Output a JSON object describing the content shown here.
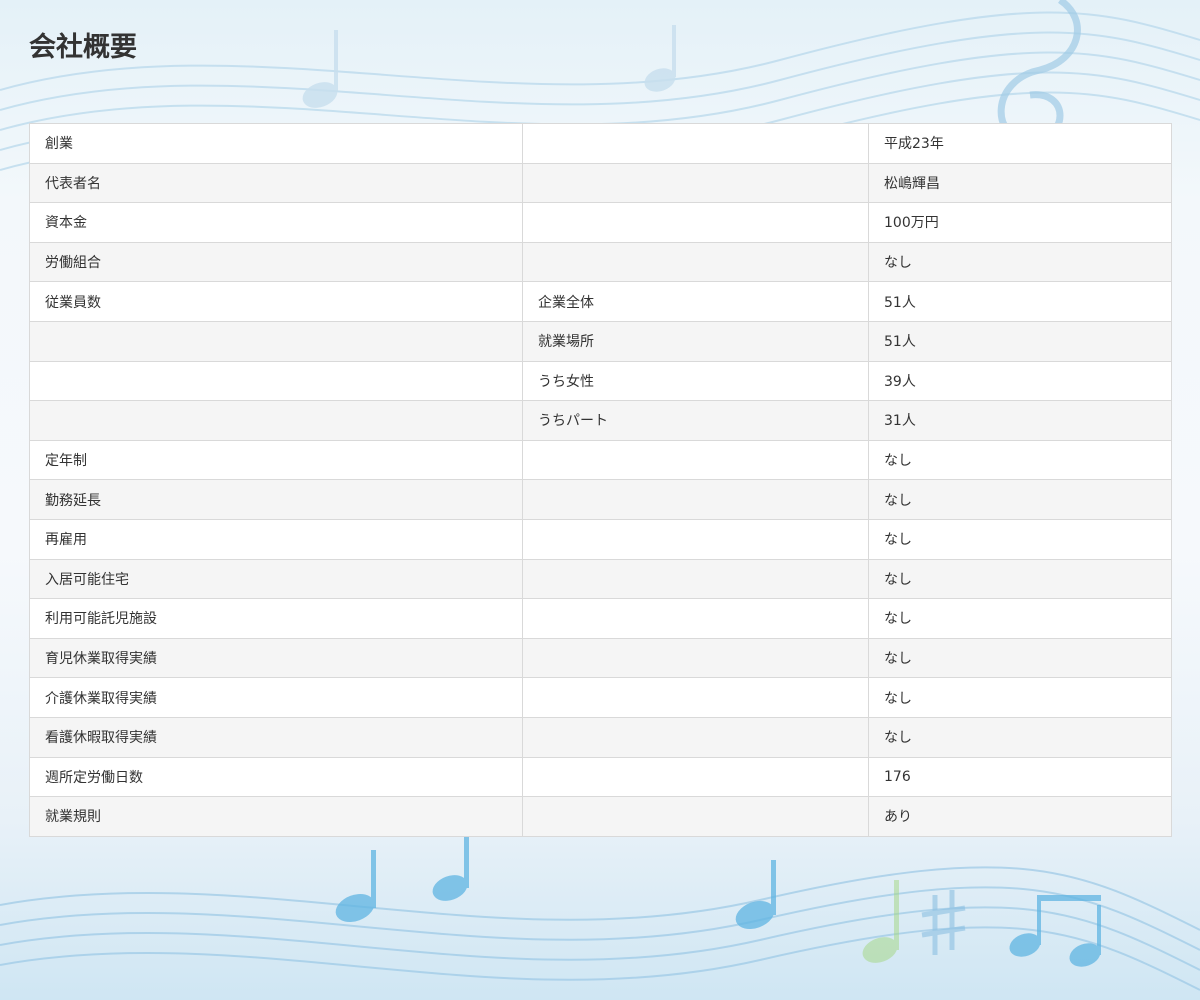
{
  "page": {
    "title": "会社概要"
  },
  "colors": {
    "title": "#333333",
    "text": "#333333",
    "border": "#d9d9d9",
    "row_odd": "#ffffff",
    "row_even": "#f5f5f5",
    "background_music_blue": "#4aa9dd"
  },
  "background": {
    "icons": [
      "music-note-icon",
      "treble-clef-icon",
      "sharp-icon",
      "staff-lines"
    ]
  },
  "table": {
    "rows": [
      {
        "label": "創業",
        "sub": "",
        "value": "平成23年"
      },
      {
        "label": "代表者名",
        "sub": "",
        "value": "松嶋輝昌"
      },
      {
        "label": "資本金",
        "sub": "",
        "value": "100万円"
      },
      {
        "label": "労働組合",
        "sub": "",
        "value": "なし"
      },
      {
        "label": "従業員数",
        "sub": "企業全体",
        "value": "51人"
      },
      {
        "label": "",
        "sub": "就業場所",
        "value": "51人"
      },
      {
        "label": "",
        "sub": "うち女性",
        "value": "39人"
      },
      {
        "label": "",
        "sub": "うちパート",
        "value": "31人"
      },
      {
        "label": "定年制",
        "sub": "",
        "value": "なし"
      },
      {
        "label": "勤務延長",
        "sub": "",
        "value": "なし"
      },
      {
        "label": "再雇用",
        "sub": "",
        "value": "なし"
      },
      {
        "label": "入居可能住宅",
        "sub": "",
        "value": "なし"
      },
      {
        "label": "利用可能託児施設",
        "sub": "",
        "value": "なし"
      },
      {
        "label": "育児休業取得実績",
        "sub": "",
        "value": "なし"
      },
      {
        "label": "介護休業取得実績",
        "sub": "",
        "value": "なし"
      },
      {
        "label": "看護休暇取得実績",
        "sub": "",
        "value": "なし"
      },
      {
        "label": "週所定労働日数",
        "sub": "",
        "value": "176"
      },
      {
        "label": "就業規則",
        "sub": "",
        "value": "あり"
      }
    ]
  }
}
